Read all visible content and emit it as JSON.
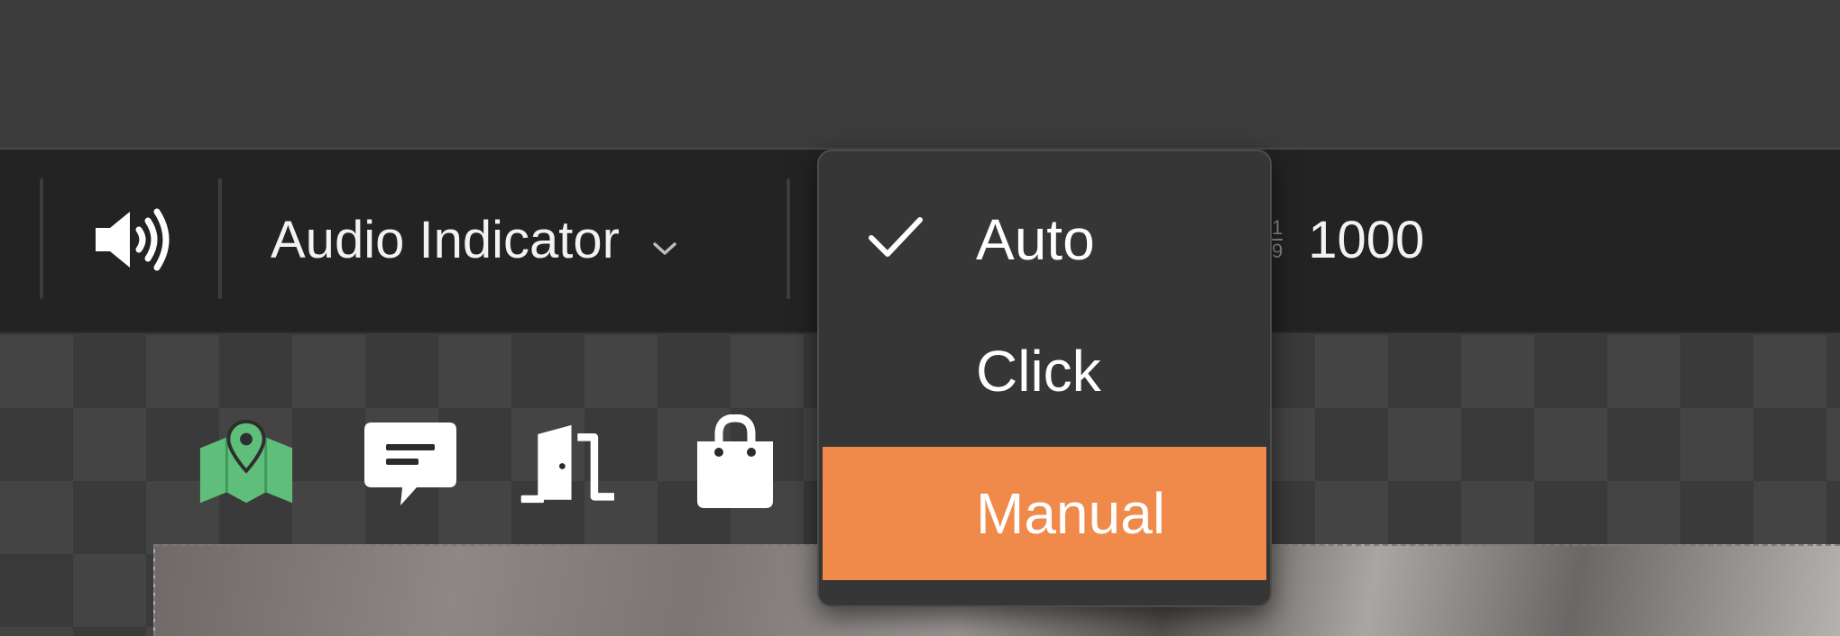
{
  "toolbar": {
    "sound_icon": "speaker-wave-icon",
    "audio_dropdown": {
      "label": "Audio Indicator",
      "chevron": "chevron-down-icon"
    },
    "value_icon": "fraction-icon",
    "value_icon_top": "1",
    "value_icon_bottom": "9",
    "value": "1000"
  },
  "dropdown_menu": {
    "items": [
      {
        "label": "Auto",
        "checked": true
      },
      {
        "label": "Click",
        "checked": false
      },
      {
        "label": "Manual",
        "checked": false,
        "highlighted": true
      }
    ],
    "check_icon": "checkmark-icon"
  },
  "canvas": {
    "hotspot_icons": [
      "map-pin-icon",
      "chat-bubble-icon",
      "door-icon",
      "shopping-bag-icon"
    ]
  },
  "colors": {
    "accent": "#ef8a4b",
    "map_green": "#5fbf7a",
    "toolbar_bg": "#232323",
    "menu_bg": "#363636"
  }
}
